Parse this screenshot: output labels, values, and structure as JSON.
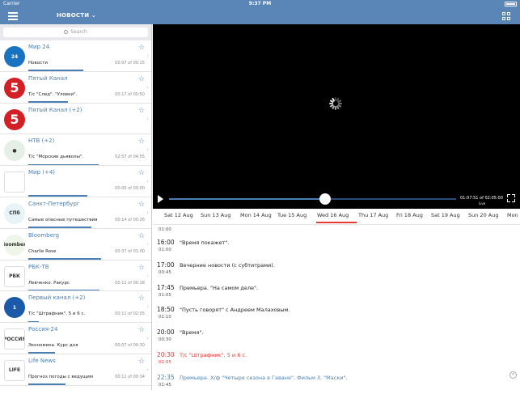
{
  "status_bar": {
    "carrier": "Carrier",
    "time": "9:37 PM",
    "battery": "100%"
  },
  "nav": {
    "title": "НОВОСТИ",
    "menu_icon": "hamburger-icon",
    "layout_icon": "grid-icon"
  },
  "search": {
    "placeholder": "Search"
  },
  "channels": [
    {
      "name": "Мир 24",
      "show": "Новости",
      "time": "00:07 of 00:15",
      "logo_text": "24",
      "logo_bg": "#1a73c0",
      "progress": 0.47
    },
    {
      "name": "Пятый Канал",
      "show": "Т/с \"След\". \"Уловки\".",
      "time": "00:17 of 00:50",
      "logo_text": "5",
      "logo_bg": "#d32027",
      "progress": 0.34
    },
    {
      "name": "Пятый Канал (+2)",
      "show": "",
      "time": "",
      "logo_text": "5",
      "logo_bg": "#d32027",
      "progress": 0
    },
    {
      "name": "НТВ (+2)",
      "show": "Т/с \"Морские дьяволы\".",
      "time": "02:57 of 04:55",
      "logo_text": "●",
      "logo_bg": "#e6efe6",
      "progress": 0.6
    },
    {
      "name": "Мир (+4)",
      "show": "",
      "time": "00:00 of 00:00",
      "logo_text": "",
      "logo_bg": "#ffffff",
      "progress": 0.5
    },
    {
      "name": "Санкт-Петербург",
      "show": "Самые опасные путешествия",
      "time": "00:14 of 00:26",
      "logo_text": "СПб",
      "logo_bg": "#e8f3f7",
      "progress": 0.54
    },
    {
      "name": "Bloomberg",
      "show": "Charlie Rose",
      "time": "00:37 of 01:00",
      "logo_text": "Bloomberg",
      "logo_bg": "#eef5e9",
      "progress": 0.62
    },
    {
      "name": "РБК-ТВ",
      "show": "Левченко. Ракурс",
      "time": "00:11 of 00:18",
      "logo_text": "РБК",
      "logo_bg": "#ffffff",
      "progress": 0.61
    },
    {
      "name": "Первый канал (+2)",
      "show": "Т/с \"Штрафник\", 5 и 6 с.",
      "time": "00:11 of 02:05",
      "logo_text": "1",
      "logo_bg": "#1a5aa8",
      "progress": 0.09
    },
    {
      "name": "Россия-24",
      "show": "Экономика. Курс дня",
      "time": "00:07 of 00:30",
      "logo_text": "РОССИЯ",
      "logo_bg": "#ffffff",
      "progress": 0.23
    },
    {
      "name": "Life News",
      "show": "Прогноз погоды с ведущим",
      "time": "00:11 of 00:34",
      "logo_text": "LIFE",
      "logo_bg": "#ffffff",
      "progress": 0.32
    }
  ],
  "player": {
    "time_display": "01:07:51 of 02:05:00",
    "live_label": "Live",
    "progress": 0.543
  },
  "days": [
    {
      "label": "Sat 12 Aug"
    },
    {
      "label": "Sun 13 Aug"
    },
    {
      "label": "Mon 14 Aug"
    },
    {
      "label": "Tue 15 Aug"
    },
    {
      "label": "Wed 16 Aug",
      "active": true
    },
    {
      "label": "Thu 17 Aug"
    },
    {
      "label": "Fri 18 Aug"
    },
    {
      "label": "Sat 19 Aug"
    },
    {
      "label": "Sun 20 Aug"
    },
    {
      "label": "Mon"
    }
  ],
  "programs": [
    {
      "time": "01:00",
      "duration": "",
      "title": ""
    },
    {
      "time": "16:00",
      "duration": "01:00",
      "title": "\"Время покажет\"."
    },
    {
      "time": "17:00",
      "duration": "00:45",
      "title": "Вечерние новости (с субтитрами)."
    },
    {
      "time": "17:45",
      "duration": "01:05",
      "title": "Премьера. \"На самом деле\"."
    },
    {
      "time": "18:50",
      "duration": "01:10",
      "title": "\"Пусть говорят\" с Андреем Малаховым."
    },
    {
      "time": "20:00",
      "duration": "00:30",
      "title": "\"Время\"."
    },
    {
      "time": "20:30",
      "duration": "02:05",
      "title": "Т/с \"Штрафник\", 5 и 6 с.",
      "state": "current"
    },
    {
      "time": "22:35",
      "duration": "01:45",
      "title": "Премьера. Х/ф \"Четыре сезона в Гаване\". Фильм 3. \"Маски\".",
      "state": "next"
    }
  ]
}
